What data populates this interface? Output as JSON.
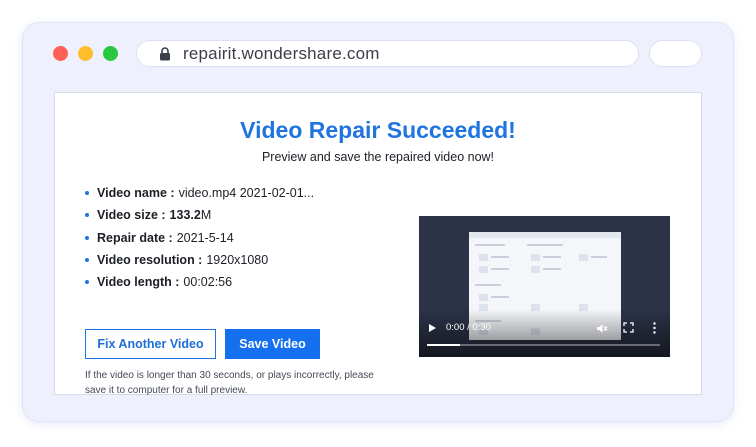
{
  "browser": {
    "url": "repairit.wondershare.com",
    "traffic_lights": [
      "#ff5f57",
      "#ffbd2e",
      "#28c840"
    ]
  },
  "result": {
    "title": "Video Repair Succeeded!",
    "subtitle": "Preview and save the repaired video now!",
    "accent_color": "#1f74e0",
    "info": {
      "name_label": "Video name :",
      "name_value": "video.mp4 2021-02-01...",
      "size_label": "Video size :",
      "size_value_bold": "133.2",
      "size_unit": "M",
      "date_label": "Repair date :",
      "date_value": "2021-5-14",
      "resolution_label": "Video resolution :",
      "resolution_value": "1920x1080",
      "length_label": "Video length :",
      "length_value": "00:02:56"
    },
    "buttons": {
      "fix_another": "Fix Another Video",
      "save": "Save Video"
    },
    "note": "If the video is longer than 30 seconds, or plays incorrectly, please save it to computer for a full preview."
  },
  "player": {
    "time": "0:00 / 0:30",
    "progress": 0.14,
    "icons": [
      "play-icon",
      "mute-icon",
      "fullscreen-icon",
      "more-options-icon"
    ]
  }
}
